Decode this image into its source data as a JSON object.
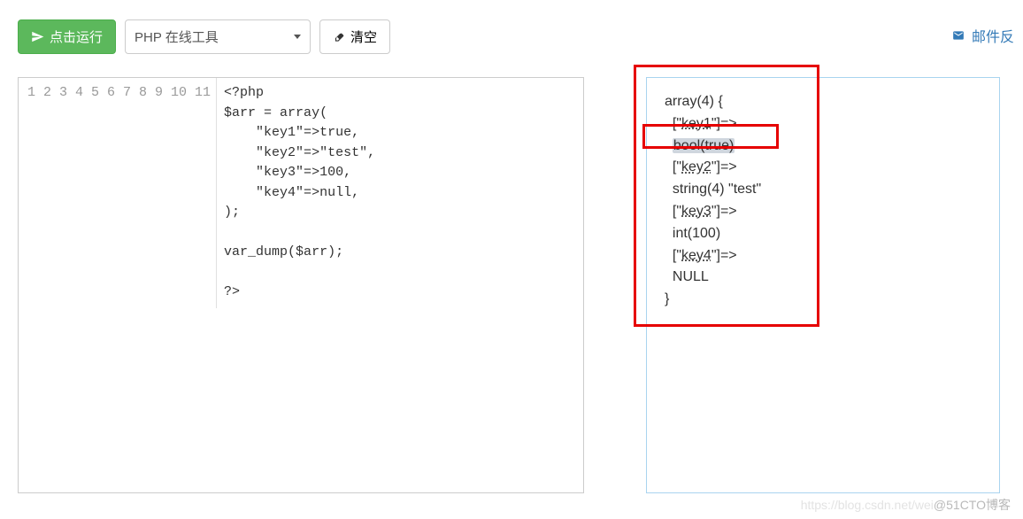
{
  "toolbar": {
    "run_label": "点击运行",
    "select_label": "PHP 在线工具",
    "clear_label": "清空",
    "feedback_label": "邮件反"
  },
  "editor": {
    "line_count": 11,
    "code_lines": [
      "<?php",
      "$arr = array(",
      "    \"key1\"=>true,",
      "    \"key2\"=>\"test\",",
      "    \"key3\"=>100,",
      "    \"key4\"=>null,",
      ");",
      "",
      "var_dump($arr);",
      "",
      "?>"
    ]
  },
  "output": {
    "lines": [
      "array(4) {",
      "  [\"key1\"]=>",
      "  bool(true)",
      "  [\"key2\"]=>",
      "  string(4) \"test\"",
      "  [\"key3\"]=>",
      "  int(100)",
      "  [\"key4\"]=>",
      "  NULL",
      "}"
    ]
  },
  "watermark": {
    "faint": "https://blog.csdn.net/wei",
    "handle": "@51CTO博客"
  }
}
